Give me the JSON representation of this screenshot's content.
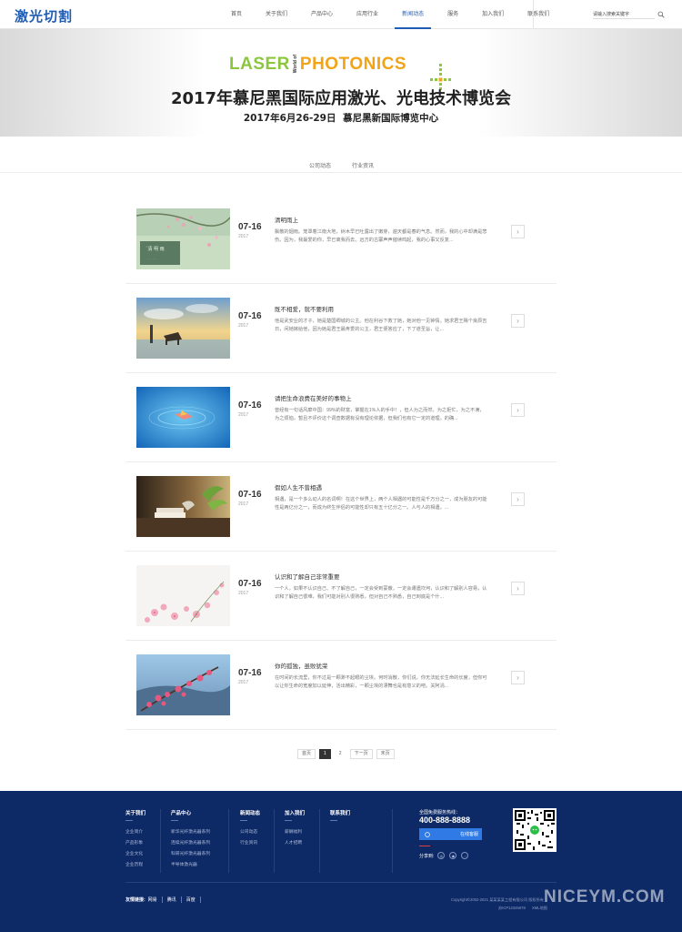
{
  "header": {
    "logo": "激光切割",
    "nav": [
      "首页",
      "关于我们",
      "产品中心",
      "应用行业",
      "新闻动态",
      "服务",
      "加入我们",
      "联系我们"
    ],
    "active_nav": "新闻动态",
    "search_placeholder": "请输入搜索关键字"
  },
  "banner": {
    "logo_left": "LASER",
    "logo_world_of": "World of",
    "logo_right": "PHOTONICS",
    "title": "2017年慕尼黑国际应用激光、光电技术博览会",
    "subtitle": "2017年6月26-29日 慕尼黑新国际博览中心"
  },
  "subnav": [
    "公司动态",
    "行业资讯"
  ],
  "news": [
    {
      "date": "07-16",
      "year": "2017",
      "title": "清明雨上",
      "summary": "飘散的烟雨。笼罩着江南大地，树木早已吐露出了嫩芽，遍天都是春的气息。然而，我的心中却满是悲伤。因为，我最爱的你，早已离我而去。远方的古寨声声催续鸣起，我的心事又反复...",
      "arrow": "›"
    },
    {
      "date": "07-16",
      "year": "2017",
      "title": "既不相爱，就不要利用",
      "summary": "他是武安业的才子，她是楚国卿城的公主。他在利谷下救了她，她对他一见钟情。她求君王赐个良辰吉日，闲她嫁给他，因为她是君王最疼爱的公主，君王便答应了，下了道圣旨，让...",
      "arrow": "›"
    },
    {
      "date": "07-16",
      "year": "2017",
      "title": "请把生命浪费在美好的事物上",
      "summary": "曾经有一句话风靡中国：99%的财富，掌握在1%人的手中！，但人为之而然，为之拒忙，为之不满，为之烦恼，暂且不评价这个调查数据有没有理论依据，但我们也有它一定的道理。的确...",
      "arrow": "›"
    },
    {
      "date": "07-16",
      "year": "2017",
      "title": "假如人生不曾相遇",
      "summary": "相遇，是一个多么动人的名词啊！在这个世界上，两个人相遇的可能性是千万分之一，成为朋友的可能性是两亿分之一，而成为终生伴侣的可能性却只有五十亿分之一。人与人的相遇，...",
      "arrow": "›"
    },
    {
      "date": "07-16",
      "year": "2017",
      "title": "认识和了解自己非常重要",
      "summary": "一个人，如果不认识自己、不了解自己，一定会受到蒙蔽，一定会遭遇坎坷，认识和了解别人容易，认识和了解自己很难，我们可能对别人很熟悉，但对自己不熟悉，自己到底是个什...",
      "arrow": "›"
    },
    {
      "date": "07-16",
      "year": "2017",
      "title": "你的孤独，虽败犹荣",
      "summary": "在时间的长流里，你不过是一颗渺不起眼的尘埃。何时消散，你们说，你无法延长生命的长度，但你可以让你生命的宽度加以延伸，活出精彩，一颗尘埃的漂舞也是有意义的吧。关阿涓...",
      "arrow": "›"
    }
  ],
  "pagination": {
    "first": "首页",
    "pages": [
      "1",
      "2"
    ],
    "current": "1",
    "next": "下一页",
    "last": "末页"
  },
  "footer": {
    "columns": [
      {
        "title": "关于我们",
        "links": [
          "企业简介",
          "产品形象",
          "企业文化",
          "企业历程"
        ]
      },
      {
        "title": "产品中心",
        "links": [
          "新华光纤激光器系列",
          "连续光纤激光器系列",
          "科研光纤激光器系列",
          "半导体激光器"
        ]
      },
      {
        "title": "新闻动态",
        "links": [
          "公司动态",
          "行业资讯"
        ]
      },
      {
        "title": "加入我们",
        "links": [
          "薪酬福利",
          "人才招聘"
        ]
      },
      {
        "title": "联系我们",
        "links": []
      }
    ],
    "hotline_label": "全国免费服务热线：",
    "hotline": "400-888-8888",
    "consult": "在线客服",
    "share_label": "分享到:",
    "friend_label": "友情链接:",
    "friend_links": [
      "网易",
      "腾讯",
      "百度"
    ],
    "copyright": "Copyright©2002-2021 某某某某工程有限公司 版权所有",
    "icp": "苏ICP12345678",
    "sitemap": "XML地图",
    "watermark": "NICEYM.COM"
  },
  "colors": {
    "brand": "#1f5cb3",
    "footer_bg": "#0e2a66",
    "laser_green": "#8cc63f",
    "photonics_orange": "#f3a416",
    "consult_btn": "#2f7ae5"
  }
}
